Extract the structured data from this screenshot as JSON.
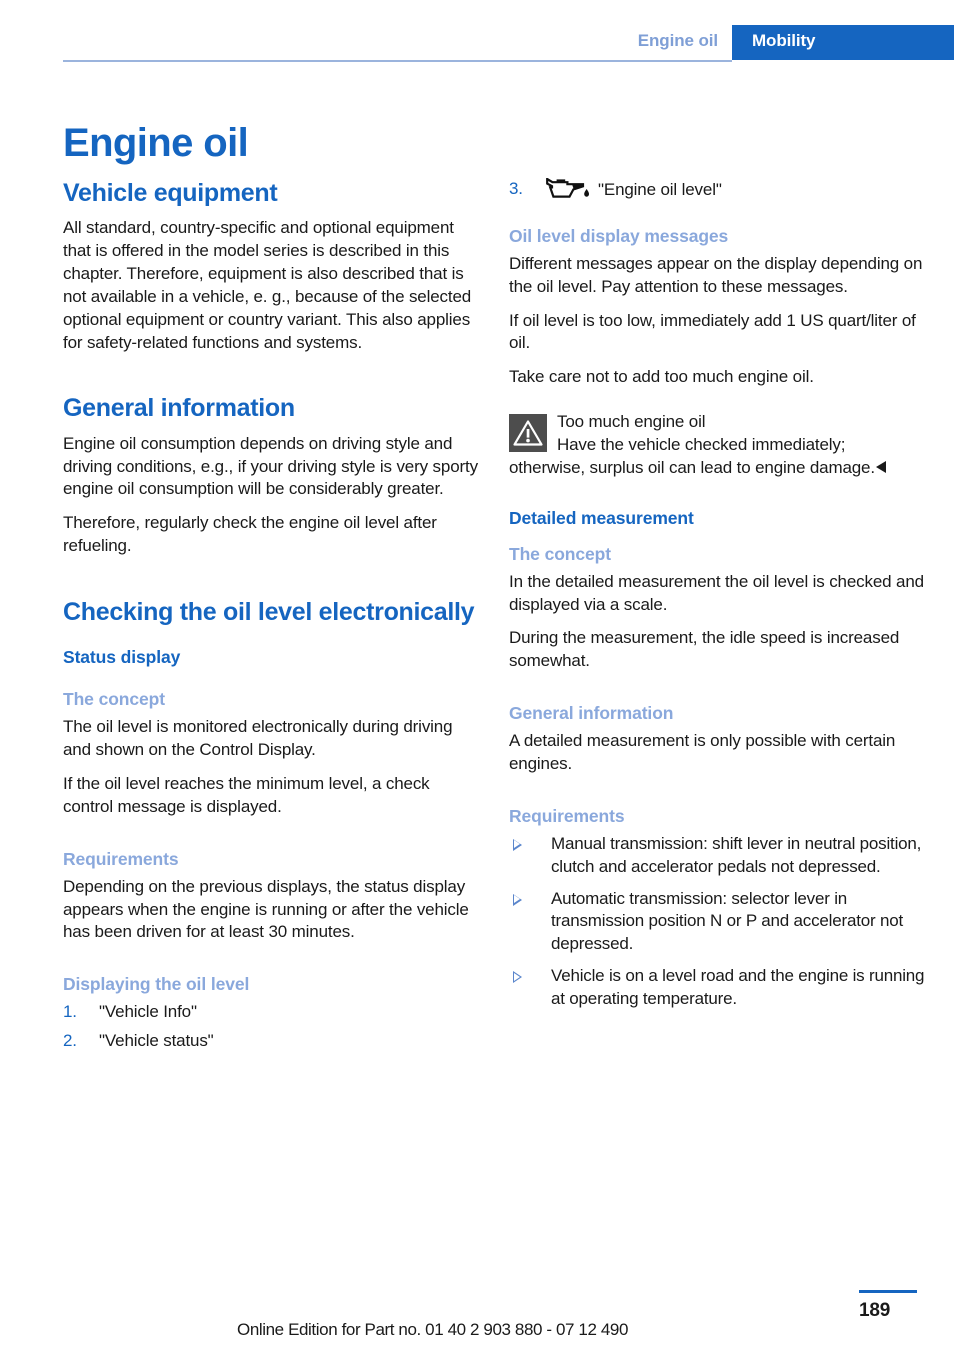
{
  "header": {
    "running_title": "Engine oil",
    "section_tab": "Mobility"
  },
  "page_title": "Engine oil",
  "left_column": {
    "vehicle_equipment": {
      "heading": "Vehicle equipment",
      "paragraph": "All standard, country-specific and optional equipment that is offered in the model series is described in this chapter. Therefore, equipment is also described that is not available in a vehicle, e. g., because of the selected optional equipment or country variant. This also applies for safety-related functions and systems."
    },
    "general_information": {
      "heading": "General information",
      "paragraph_1": "Engine oil consumption depends on driving style and driving conditions, e.g., if your driving style is very sporty engine oil consumption will be considerably greater.",
      "paragraph_2": "Therefore, regularly check the engine oil level after refueling."
    },
    "checking_oil_level": {
      "heading": "Checking the oil level electronically",
      "status_display_heading": "Status display",
      "the_concept_heading": "The concept",
      "the_concept_p1": "The oil level is monitored electronically during driving and shown on the Control Display.",
      "the_concept_p2": "If the oil level reaches the minimum level, a check control message is displayed.",
      "requirements_heading": "Requirements",
      "requirements_paragraph": "Depending on the previous displays, the status display appears when the engine is running or after the vehicle has been driven for at least 30 minutes.",
      "displaying_heading": "Displaying the oil level",
      "steps": [
        {
          "number": "1.",
          "text": "\"Vehicle Info\""
        },
        {
          "number": "2.",
          "text": "\"Vehicle status\""
        }
      ]
    }
  },
  "right_column": {
    "step_3": {
      "number": "3.",
      "icon": "oil-can-icon",
      "text": "\"Engine oil level\""
    },
    "oil_level_display_messages": {
      "heading": "Oil level display messages",
      "paragraph_1": "Different messages appear on the display depending on the oil level. Pay attention to these messages.",
      "paragraph_2": "If oil level is too low, immediately add 1 US quart/liter of oil.",
      "paragraph_3": "Take care not to add too much engine oil."
    },
    "warning": {
      "icon": "warning-triangle-icon",
      "title": "Too much engine oil",
      "body_start": "Have the vehicle checked immediately;",
      "body_rest": "otherwise, surplus oil can lead to engine damage.",
      "end_marker": "◄"
    },
    "detailed_measurement": {
      "heading": "Detailed measurement",
      "the_concept_heading": "The concept",
      "the_concept_p1": "In the detailed measurement the oil level is checked and displayed via a scale.",
      "the_concept_p2": "During the measurement, the idle speed is increased somewhat.",
      "general_information_heading": "General information",
      "general_information_p1": "A detailed measurement is only possible with certain engines.",
      "requirements_heading": "Requirements",
      "requirements_items": [
        "Manual transmission: shift lever in neutral position, clutch and accelerator pedals not depressed.",
        "Automatic transmission: selector lever in transmission position N or P and accelerator not depressed.",
        "Vehicle is on a level road and the engine is running at operating temperature."
      ]
    }
  },
  "footer": {
    "note": "Online Edition for Part no. 01 40 2 903 880 - 07 12 490",
    "page_number": "189"
  },
  "colors": {
    "accent_blue": "#1565c0",
    "light_blue": "#8aa8dc",
    "rule_blue": "#9bb4dd",
    "warning_box": "#4d4d4d",
    "text": "#1a1a1a"
  }
}
